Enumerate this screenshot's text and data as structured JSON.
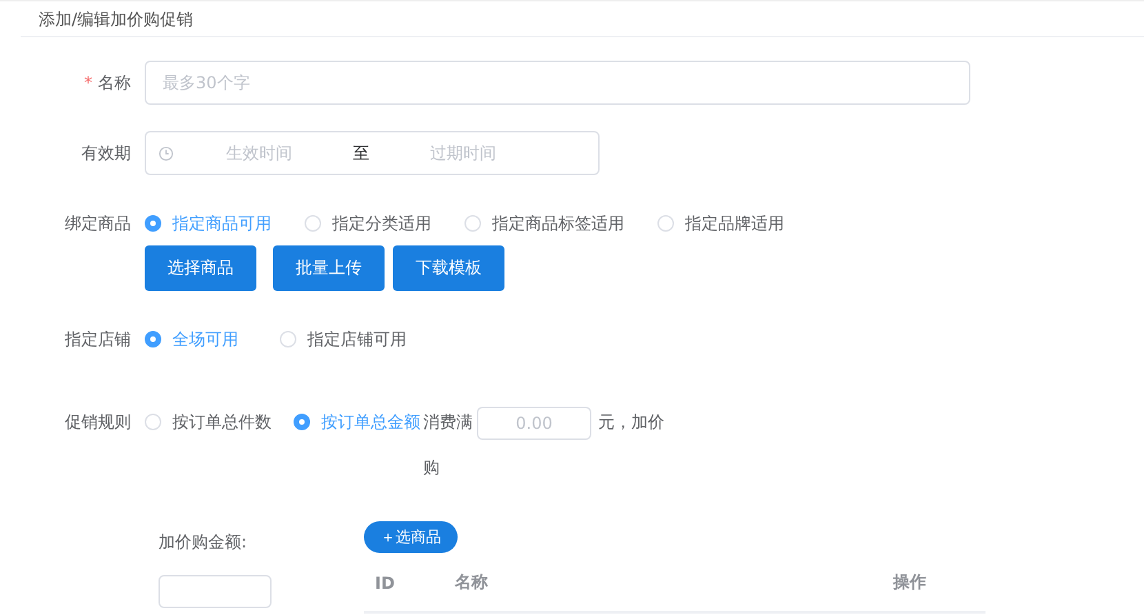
{
  "title": "添加/编辑加价购促销",
  "name_field": {
    "label": "名称",
    "required": true,
    "required_mark": "*",
    "placeholder": "最多30个字"
  },
  "validity": {
    "label": "有效期",
    "start_placeholder": "生效时间",
    "separator": "至",
    "end_placeholder": "过期时间"
  },
  "bind_goods": {
    "label": "绑定商品",
    "options": [
      {
        "label": "指定商品可用",
        "selected": true
      },
      {
        "label": "指定分类适用",
        "selected": false
      },
      {
        "label": "指定商品标签适用",
        "selected": false
      },
      {
        "label": "指定品牌适用",
        "selected": false
      }
    ],
    "buttons": [
      "选择商品",
      "批量上传",
      "下载模板"
    ]
  },
  "store": {
    "label": "指定店铺",
    "options": [
      {
        "label": "全场可用",
        "selected": true
      },
      {
        "label": "指定店铺可用",
        "selected": false
      }
    ]
  },
  "rule": {
    "label": "促销规则",
    "options": [
      {
        "label": "按订单总件数",
        "selected": false
      },
      {
        "label": "按订单总金额",
        "selected": true
      }
    ],
    "threshold_prefix": "消费满",
    "threshold_placeholder": "0.00",
    "threshold_suffix_lines": [
      "元，加价",
      "购"
    ]
  },
  "addon": {
    "label": "加价购金额:",
    "add_button": "＋选商品",
    "columns": [
      "ID",
      "名称",
      "操作"
    ]
  }
}
